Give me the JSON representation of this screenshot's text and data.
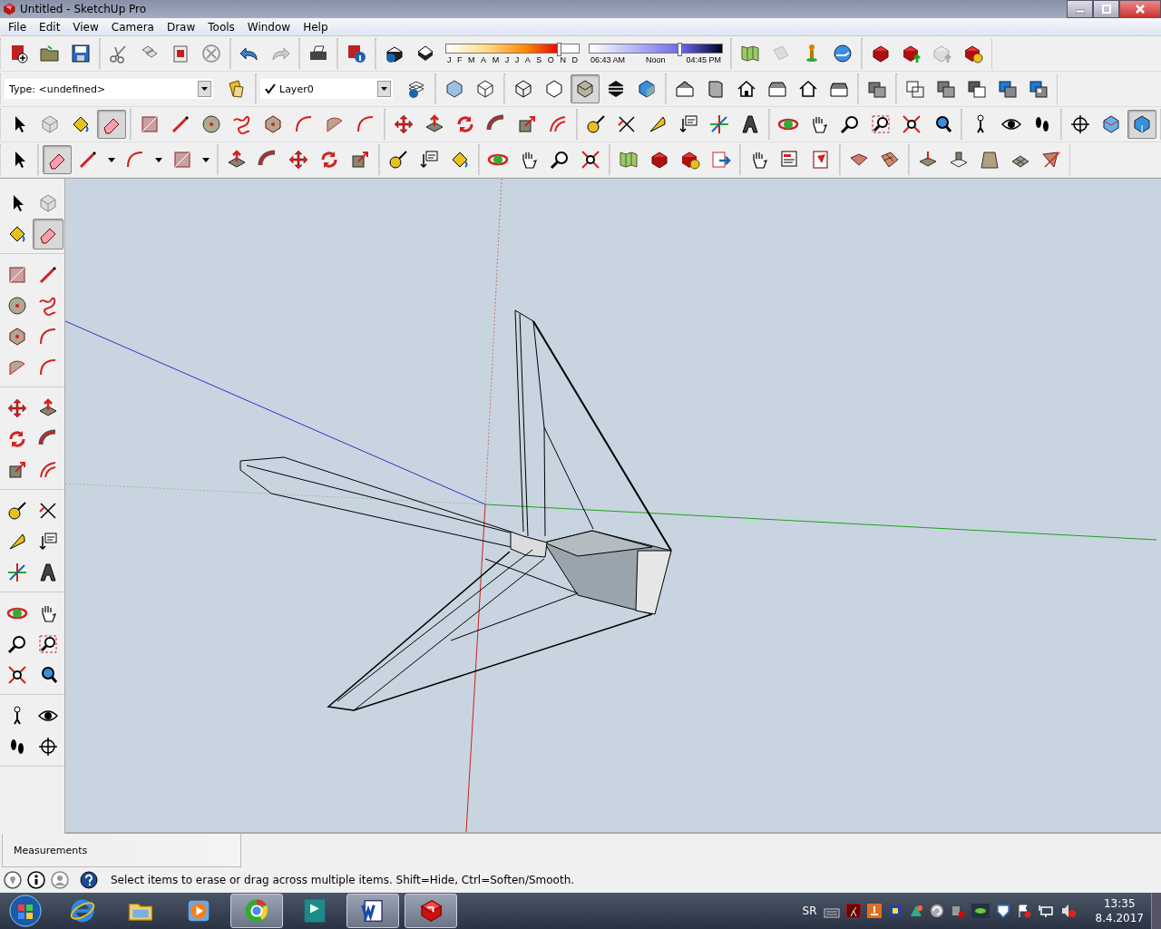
{
  "window": {
    "title": "Untitled - SketchUp Pro"
  },
  "menu": [
    "File",
    "Edit",
    "View",
    "Camera",
    "Draw",
    "Tools",
    "Window",
    "Help"
  ],
  "toolbar_rows": [
    [
      [
        {
          "kind": "new",
          "selected": false
        },
        {
          "kind": "open",
          "selected": false
        },
        {
          "kind": "save",
          "selected": false
        }
      ],
      [
        {
          "kind": "cut",
          "selected": false
        },
        {
          "kind": "copy",
          "selected": false
        },
        {
          "kind": "paste",
          "selected": false
        },
        {
          "kind": "delete",
          "selected": false
        }
      ],
      [
        {
          "kind": "undo",
          "selected": false
        },
        {
          "kind": "redo",
          "selected": false
        }
      ],
      [
        {
          "kind": "print",
          "selected": false
        }
      ],
      [
        {
          "kind": "modelinfo",
          "selected": false
        }
      ],
      [
        {
          "kind": "shadows",
          "selected": false
        },
        {
          "kind": "fog",
          "selected": false
        },
        {
          "kind": "shadow-sliders",
          "months": [
            "J",
            "F",
            "M",
            "A",
            "M",
            "J",
            "J",
            "A",
            "S",
            "O",
            "N",
            "D"
          ],
          "date_slider": {
            "level": 0.85
          },
          "times": [
            "06:43 AM",
            "Noon",
            "04:45 PM"
          ],
          "time_slider": {
            "level": 0.68
          }
        }
      ],
      [
        {
          "kind": "geo",
          "selected": false
        },
        {
          "kind": "photo",
          "selected": false
        },
        {
          "kind": "person",
          "selected": false
        },
        {
          "kind": "earth",
          "selected": false
        }
      ],
      [
        {
          "kind": "warehouse",
          "selected": false
        },
        {
          "kind": "share",
          "selected": false
        },
        {
          "kind": "upload",
          "selected": false
        },
        {
          "kind": "reload",
          "selected": false
        }
      ]
    ],
    [
      [
        {
          "kind": "type-field",
          "value": "Type: <undefined>"
        },
        {
          "kind": "tags",
          "selected": false
        }
      ],
      [
        {
          "kind": "layer-field",
          "checked": true,
          "value": "Layer0"
        },
        {
          "kind": "layerinfo",
          "selected": false
        }
      ],
      [
        {
          "kind": "xray",
          "selected": false
        },
        {
          "kind": "backedges",
          "selected": false
        }
      ],
      [
        {
          "kind": "wireframe",
          "selected": false
        },
        {
          "kind": "hidden",
          "selected": false
        },
        {
          "kind": "shaded",
          "selected": true
        },
        {
          "kind": "textured",
          "selected": false
        },
        {
          "kind": "mono",
          "selected": false
        }
      ],
      [
        {
          "kind": "iso",
          "selected": false
        },
        {
          "kind": "top",
          "selected": false
        },
        {
          "kind": "front",
          "selected": false
        },
        {
          "kind": "right",
          "selected": false
        },
        {
          "kind": "back",
          "selected": false
        },
        {
          "kind": "left",
          "selected": false
        }
      ],
      [
        {
          "kind": "solid",
          "selected": false
        }
      ],
      [
        {
          "kind": "union",
          "selected": false
        },
        {
          "kind": "subtract",
          "selected": false
        },
        {
          "kind": "trim",
          "selected": false
        },
        {
          "kind": "split",
          "selected": false
        },
        {
          "kind": "bluebox",
          "selected": false
        }
      ]
    ],
    [
      [
        {
          "kind": "select",
          "selected": false
        },
        {
          "kind": "component",
          "selected": false
        },
        {
          "kind": "paint",
          "selected": false
        },
        {
          "kind": "eraser",
          "selected": true
        }
      ],
      [
        {
          "kind": "rect",
          "selected": false
        },
        {
          "kind": "line",
          "selected": false
        },
        {
          "kind": "circle",
          "selected": false
        },
        {
          "kind": "freehand",
          "selected": false
        },
        {
          "kind": "polygon",
          "selected": false
        },
        {
          "kind": "arc",
          "selected": false
        },
        {
          "kind": "pie",
          "selected": false
        },
        {
          "kind": "arc",
          "selected": false
        }
      ],
      [
        {
          "kind": "move",
          "selected": false
        },
        {
          "kind": "pushpull",
          "selected": false
        },
        {
          "kind": "rotate",
          "selected": false
        },
        {
          "kind": "followme",
          "selected": false
        },
        {
          "kind": "scale",
          "selected": false
        },
        {
          "kind": "offset",
          "selected": false
        }
      ],
      [
        {
          "kind": "tape",
          "selected": false
        },
        {
          "kind": "dimension",
          "selected": false
        },
        {
          "kind": "protractor",
          "selected": false
        },
        {
          "kind": "text",
          "selected": false
        },
        {
          "kind": "axes",
          "selected": false
        },
        {
          "kind": "text3d",
          "selected": false
        }
      ],
      [
        {
          "kind": "orbit",
          "selected": false
        },
        {
          "kind": "pan",
          "selected": false
        },
        {
          "kind": "zoom",
          "selected": false
        },
        {
          "kind": "zoomwindow",
          "selected": false
        },
        {
          "kind": "extents",
          "selected": false
        },
        {
          "kind": "previous",
          "selected": false
        }
      ],
      [
        {
          "kind": "position",
          "selected": false
        },
        {
          "kind": "look",
          "selected": false
        },
        {
          "kind": "walk",
          "selected": false
        }
      ],
      [
        {
          "kind": "section",
          "selected": false
        },
        {
          "kind": "sectionplane",
          "selected": false
        },
        {
          "kind": "sectioncut",
          "selected": true
        }
      ]
    ],
    [
      [
        {
          "kind": "select",
          "selected": false
        }
      ],
      [
        {
          "kind": "eraser",
          "selected": true
        },
        {
          "kind": "line",
          "selected": false
        },
        {
          "kind": "caret"
        },
        {
          "kind": "arc",
          "selected": false
        },
        {
          "kind": "caret"
        },
        {
          "kind": "rect",
          "selected": false
        },
        {
          "kind": "caret"
        }
      ],
      [
        {
          "kind": "pushpull",
          "selected": false
        },
        {
          "kind": "followme",
          "selected": false
        },
        {
          "kind": "move",
          "selected": false
        },
        {
          "kind": "rotate",
          "selected": false
        },
        {
          "kind": "scale",
          "selected": false
        }
      ],
      [
        {
          "kind": "tape",
          "selected": false
        },
        {
          "kind": "text",
          "selected": false
        },
        {
          "kind": "paint",
          "selected": false
        }
      ],
      [
        {
          "kind": "orbit",
          "selected": false
        },
        {
          "kind": "pan",
          "selected": false
        },
        {
          "kind": "zoom",
          "selected": false
        },
        {
          "kind": "extents",
          "selected": false
        }
      ],
      [
        {
          "kind": "geo",
          "selected": false
        },
        {
          "kind": "warehouse",
          "selected": false
        },
        {
          "kind": "reload",
          "selected": false
        },
        {
          "kind": "export",
          "selected": false
        }
      ],
      [
        {
          "kind": "pan",
          "selected": false
        },
        {
          "kind": "presentation",
          "selected": false
        },
        {
          "kind": "layout",
          "selected": false
        }
      ],
      [
        {
          "kind": "sandbox",
          "selected": false
        },
        {
          "kind": "grid",
          "selected": false
        }
      ],
      [
        {
          "kind": "smoove",
          "selected": false
        },
        {
          "kind": "stamp",
          "selected": false
        },
        {
          "kind": "drape",
          "selected": false
        },
        {
          "kind": "detail",
          "selected": false
        },
        {
          "kind": "flip",
          "selected": false
        }
      ]
    ]
  ],
  "palette": [
    [
      {
        "kind": "select",
        "selected": false
      },
      {
        "kind": "component",
        "selected": false
      },
      {
        "kind": "paint",
        "selected": false
      },
      {
        "kind": "eraser",
        "selected": true
      }
    ],
    [
      {
        "kind": "rect",
        "selected": false
      },
      {
        "kind": "line",
        "selected": false
      },
      {
        "kind": "circle",
        "selected": false
      },
      {
        "kind": "freehand",
        "selected": false
      },
      {
        "kind": "polygon",
        "selected": false
      },
      {
        "kind": "arc",
        "selected": false
      },
      {
        "kind": "pie",
        "selected": false
      },
      {
        "kind": "arc",
        "selected": false
      }
    ],
    [
      {
        "kind": "move",
        "selected": false
      },
      {
        "kind": "pushpull",
        "selected": false
      },
      {
        "kind": "rotate",
        "selected": false
      },
      {
        "kind": "followme",
        "selected": false
      },
      {
        "kind": "scale",
        "selected": false
      },
      {
        "kind": "offset",
        "selected": false
      }
    ],
    [
      {
        "kind": "tape",
        "selected": false
      },
      {
        "kind": "dimension",
        "selected": false
      },
      {
        "kind": "protractor",
        "selected": false
      },
      {
        "kind": "text",
        "selected": false
      },
      {
        "kind": "axes",
        "selected": false
      },
      {
        "kind": "text3d",
        "selected": false
      }
    ],
    [
      {
        "kind": "orbit",
        "selected": false
      },
      {
        "kind": "pan",
        "selected": false
      },
      {
        "kind": "zoom",
        "selected": false
      },
      {
        "kind": "zoomwindow",
        "selected": false
      },
      {
        "kind": "extents",
        "selected": false
      },
      {
        "kind": "previous",
        "selected": false
      }
    ],
    [
      {
        "kind": "position",
        "selected": false
      },
      {
        "kind": "look",
        "selected": false
      },
      {
        "kind": "walk",
        "selected": false
      },
      {
        "kind": "section",
        "selected": false
      }
    ]
  ],
  "measurements": {
    "label": "Measurements"
  },
  "status": {
    "message": "Select items to erase or drag across multiple items. Shift=Hide, Ctrl=Soften/Smooth."
  },
  "taskbar": {
    "apps": [
      {
        "kind": "ie",
        "open": false
      },
      {
        "kind": "folder",
        "open": false
      },
      {
        "kind": "media",
        "open": false
      },
      {
        "kind": "chrome",
        "open": true
      },
      {
        "kind": "max",
        "open": false
      },
      {
        "kind": "word",
        "open": true
      },
      {
        "kind": "sketchup",
        "open": true
      }
    ],
    "language": "SR",
    "time": "13:35",
    "date": "8.4.2017"
  }
}
